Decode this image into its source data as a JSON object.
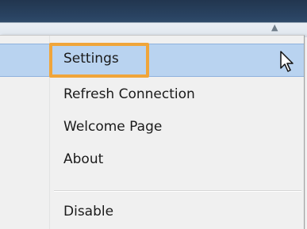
{
  "menu": {
    "items": [
      {
        "label": "Settings"
      },
      {
        "label": "Refresh Connection"
      },
      {
        "label": "Welcome Page"
      },
      {
        "label": "About"
      },
      {
        "label": "Disable"
      }
    ]
  },
  "icons": {
    "cursor": "mouse-pointer-icon",
    "toolbar": "pin-icon"
  },
  "colors": {
    "hover_background": "#b9d3f0",
    "highlight_border": "#f0a53a",
    "menu_background": "#f0f0f0"
  }
}
